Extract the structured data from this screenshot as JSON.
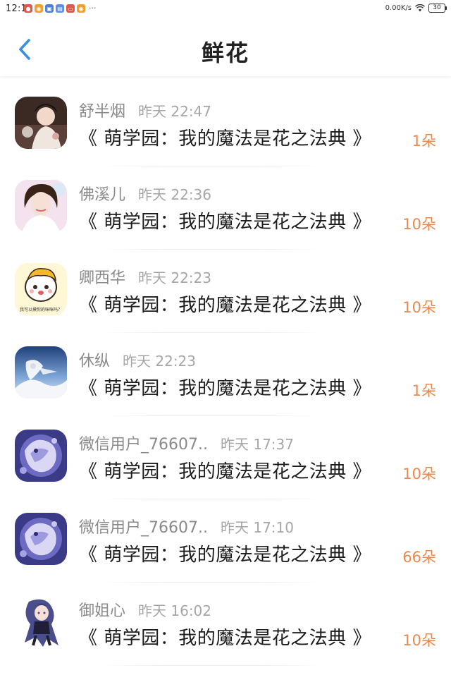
{
  "status_bar": {
    "time": "12:10",
    "dots": "···",
    "net_speed": "0.00K/s",
    "battery": "30",
    "notification_icons": [
      {
        "name": "app-notification-icon",
        "color": "#e2574c",
        "glyph": "●"
      },
      {
        "name": "weibo-icon",
        "color": "#f0a030",
        "glyph": "◉"
      },
      {
        "name": "blue-app-icon",
        "color": "#4a7fd6",
        "glyph": "▣"
      },
      {
        "name": "facetime-app-icon",
        "color": "#5c8ee6",
        "glyph": "▤"
      },
      {
        "name": "red-app-icon",
        "color": "#e2574c",
        "glyph": "▭"
      },
      {
        "name": "weibo-icon-2",
        "color": "#f0a030",
        "glyph": "◉"
      }
    ]
  },
  "header": {
    "title": "鲜花",
    "back_icon": "chevron-left-icon"
  },
  "colors": {
    "accent_blue": "#3a8ee6",
    "flower_count": "#e88a4f",
    "name_gray": "#8a8a8a",
    "time_gray": "#a6a6a6"
  },
  "gifts": [
    {
      "sender": "舒半烟",
      "time": "昨天 22:47",
      "book": "《 萌学园：我的魔法是花之法典 》",
      "count": "1朵"
    },
    {
      "sender": "佛溪儿",
      "time": "昨天 22:36",
      "book": "《 萌学园：我的魔法是花之法典 》",
      "count": "10朵"
    },
    {
      "sender": "卿西华",
      "time": "昨天 22:23",
      "book": "《 萌学园：我的魔法是花之法典 》",
      "count": "10朵"
    },
    {
      "sender": "休纵",
      "time": "昨天 22:23",
      "book": "《 萌学园：我的魔法是花之法典 》",
      "count": "1朵"
    },
    {
      "sender": "微信用户_76607..",
      "time": "昨天 17:37",
      "book": "《 萌学园：我的魔法是花之法典 》",
      "count": "10朵"
    },
    {
      "sender": "微信用户_76607..",
      "time": "昨天 17:10",
      "book": "《 萌学园：我的魔法是花之法典 》",
      "count": "66朵"
    },
    {
      "sender": "御姐心",
      "time": "昨天 16:02",
      "book": "《 萌学园：我的魔法是花之法典 》",
      "count": "10朵"
    }
  ],
  "avatar_sticker_text": "我可以摸你的咪咪吗？"
}
